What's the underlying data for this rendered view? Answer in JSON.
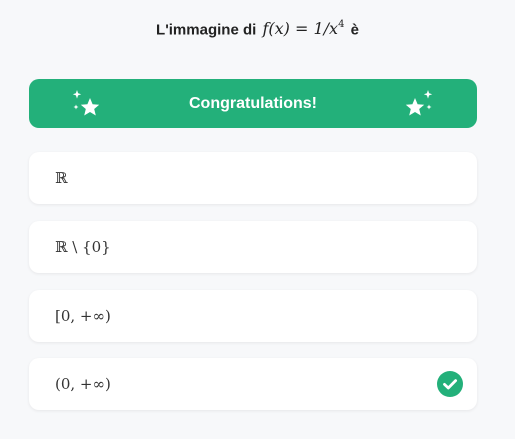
{
  "question": {
    "prefix": "L'immagine di",
    "math": "f(x) = 1/x",
    "exponent": "4",
    "suffix": "è"
  },
  "banner": {
    "text": "Congratulations!",
    "color": "#23b07a",
    "left_icon": "sparkle-stars-icon",
    "right_icon": "sparkle-stars-icon"
  },
  "options": [
    {
      "label": "ℝ",
      "selected": false
    },
    {
      "label": "ℝ \\ {0}",
      "selected": false
    },
    {
      "label": "[0, +∞)",
      "selected": false
    },
    {
      "label": "(0, +∞)",
      "selected": true,
      "status_icon": "check-circle-icon"
    }
  ]
}
